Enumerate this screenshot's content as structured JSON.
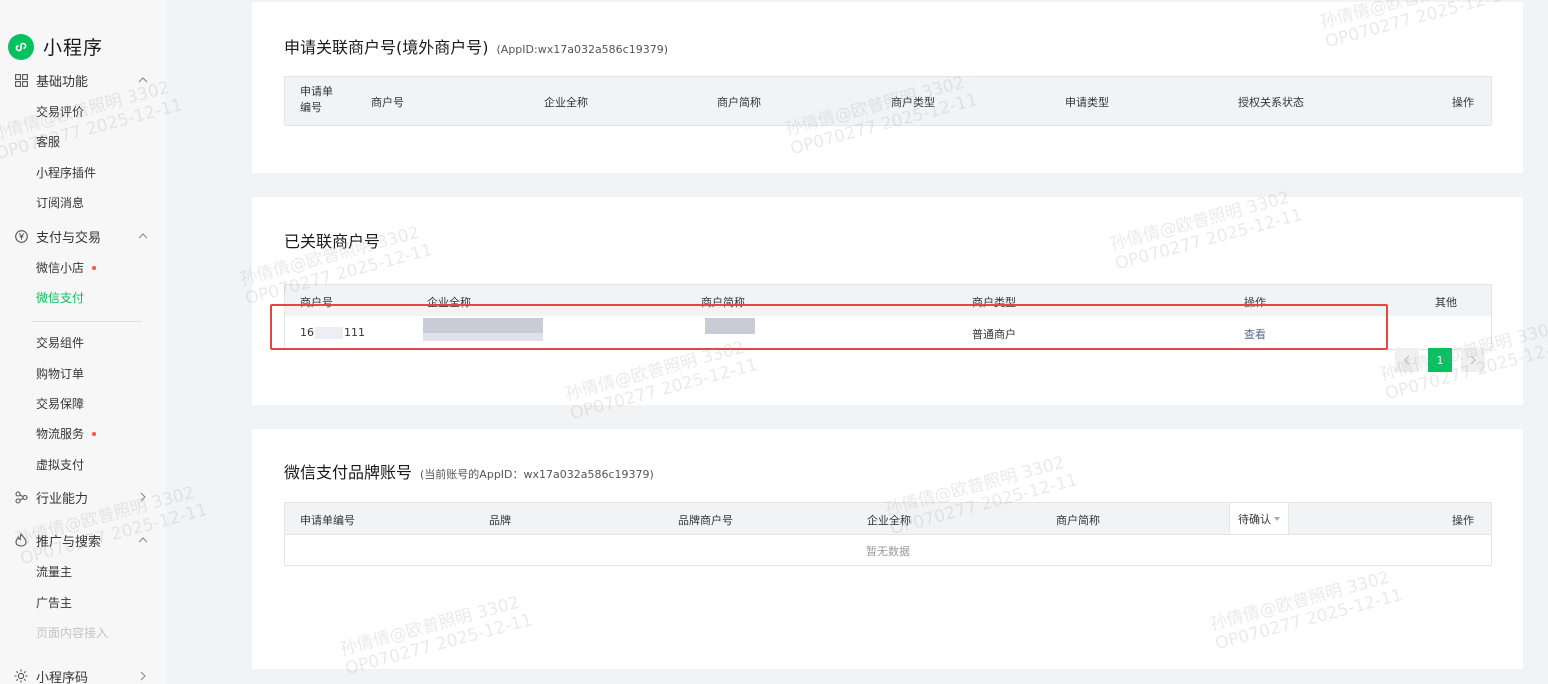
{
  "app": {
    "name": "小程序"
  },
  "sidebar": {
    "sections": [
      {
        "label": "基础功能",
        "icon": "grid-icon"
      },
      {
        "label": "支付与交易",
        "icon": "yuan-circle-icon"
      },
      {
        "label": "行业能力",
        "icon": "share-nodes-icon"
      },
      {
        "label": "推广与搜索",
        "icon": "flame-icon"
      },
      {
        "label": "小程序码",
        "icon": "sun-gear-icon"
      }
    ],
    "basic_items": [
      "交易评价",
      "客服",
      "小程序插件",
      "订阅消息"
    ],
    "pay_items": [
      "微信小店",
      "微信支付"
    ],
    "pay_items2": [
      "交易组件",
      "购物订单",
      "交易保障",
      "物流服务",
      "虚拟支付"
    ],
    "promo_items": [
      "流量主",
      "广告主",
      "页面内容接入"
    ]
  },
  "apply_card": {
    "title": "申请关联商户号(境外商户号)",
    "appid_note": "(AppID:wx17a032a586c19379)",
    "headers": [
      "申请单编号",
      "商户号",
      "企业全称",
      "商户简称",
      "商户类型",
      "申请类型",
      "授权关系状态",
      "操作"
    ]
  },
  "linked_card": {
    "title": "已关联商户号",
    "headers": [
      "商户号",
      "企业全称",
      "商户简称",
      "商户类型",
      "操作",
      "其他"
    ],
    "rows": [
      {
        "merchant_no_prefix": "16",
        "merchant_no_suffix": "111",
        "merchant_type": "普通商户",
        "action": "查看"
      }
    ],
    "pagination": {
      "current": "1"
    }
  },
  "brand_card": {
    "title": "微信支付品牌账号",
    "appid_note": "(当前账号的AppID：wx17a032a586c19379)",
    "headers": [
      "申请单编号",
      "品牌",
      "品牌商户号",
      "企业全称",
      "商户简称",
      "待确认",
      "操作"
    ],
    "empty_text": "暂无数据"
  },
  "watermark": {
    "line1": "孙倩倩@欧普照明 3302",
    "line2": "OP070277 2025-12-11"
  },
  "colors": {
    "accent": "#07c160",
    "link": "#576b95",
    "highlight": "#e54545",
    "dot": "#fa5151"
  }
}
